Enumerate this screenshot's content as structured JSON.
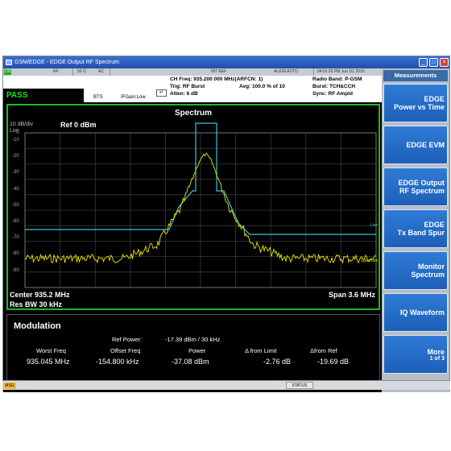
{
  "window": {
    "title": "GSM/EDGE - EDGE Output RF Spectrum",
    "buttons": [
      "minimize",
      "restore",
      "close"
    ]
  },
  "statusbar_top": {
    "lxi": "LXI",
    "rf": "RF",
    "impedance": "50 Ω",
    "coupling": "AC",
    "trigger": "INT REF",
    "align": "ALIGN AUTO",
    "clock": "04:01:29 PM Jun 10, 2010"
  },
  "info": {
    "ch_freq": "CH Freq: 935.200 000 MHz(ARFCN: 1)",
    "trig": "Trig: RF Burst",
    "avg": "Avg: 100.0 % of 10",
    "atten": "Atten: 6 dB",
    "radio_band": "Radio Band: P-GSM",
    "burst": "Burst: TCH&CCH",
    "sync": "Sync: RF Ampld",
    "pass": "PASS",
    "bts": "BTS",
    "ifgain": "IFGain:Low"
  },
  "plot": {
    "title": "Spectrum",
    "scale": "10 dB/div",
    "log": "Log",
    "ref": "Ref  0 dBm",
    "y_labels": [
      "-10",
      "-20",
      "-30",
      "-40",
      "-50",
      "-60",
      "-70",
      "-80",
      "-90"
    ],
    "line_label": "Line",
    "spectrum_label": "Spectrum",
    "center": "Center  935.2 MHz",
    "res_bw": "Res BW  30 kHz",
    "span": "Span 3.6 MHz",
    "colors": {
      "trace": "#e8e800",
      "limit": "#39c5d9",
      "grid": "#3a3a3a",
      "border": "#21b821"
    }
  },
  "modulation": {
    "title": "Modulation",
    "ref_power_label": "Ref Power:",
    "ref_power_value": "-17.39 dBm /  30 kHz",
    "headers": [
      "Worst Freq",
      "Offset Freq",
      "Power",
      "Δ from Limit",
      "Δfrom Ref"
    ],
    "values": [
      "935.045 MHz",
      "-154.800 kHz",
      "-37.08 dBm",
      "-2.76 dB",
      "-19.69 dB"
    ]
  },
  "softkeys": {
    "header": "Measurements",
    "items": [
      {
        "l1": "EDGE",
        "l2": "Power vs Time"
      },
      {
        "l1": "EDGE EVM",
        "l2": ""
      },
      {
        "l1": "EDGE Output",
        "l2": "RF Spectrum"
      },
      {
        "l1": "EDGE",
        "l2": "Tx Band Spur"
      },
      {
        "l1": "Monitor",
        "l2": "Spectrum"
      },
      {
        "l1": "IQ Waveform",
        "l2": ""
      },
      {
        "l1": "More",
        "l2": "1 of 3"
      }
    ]
  },
  "bottombar": {
    "msg": "MSG",
    "status": "STATUS"
  }
}
